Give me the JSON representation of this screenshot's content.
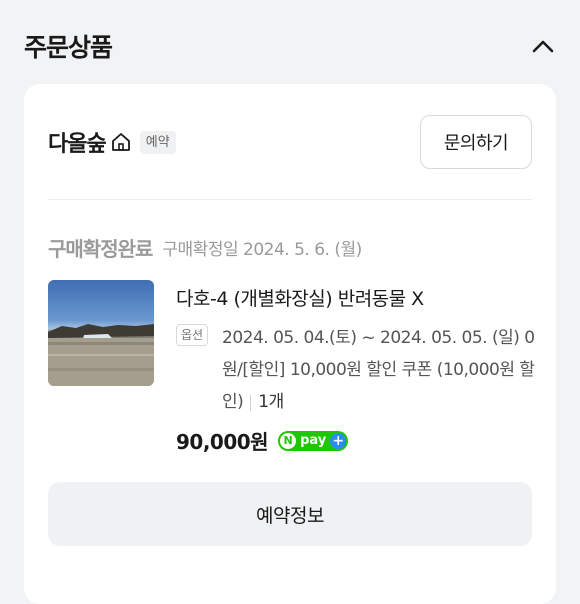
{
  "section": {
    "title": "주문상품",
    "collapse_icon": "chevron-up-icon"
  },
  "store": {
    "name": "다올숲",
    "icon": "home-icon",
    "tag": "예약",
    "inquiry_label": "문의하기"
  },
  "order": {
    "status": "구매확정완료",
    "confirm_date": "구매확정일 2024. 5. 6. (월)"
  },
  "product": {
    "name": "다호-4 (개별화장실) 반려동물 X",
    "option_badge": "옵션",
    "option_text": "2024. 05. 04.(토) ~ 2024. 05. 05. (일) 0원/[할인] 10,000원 할인 쿠폰 (10,000원 할인)",
    "quantity": "1개",
    "price": "90,000원",
    "pay_badge": {
      "n": "N",
      "label": "pay",
      "plus": "+"
    }
  },
  "reservation_button_label": "예약정보",
  "colors": {
    "npay_green": "#1ec800",
    "npay_plus_blue": "#2a8bf2",
    "status_gray": "#9a9a9a"
  }
}
